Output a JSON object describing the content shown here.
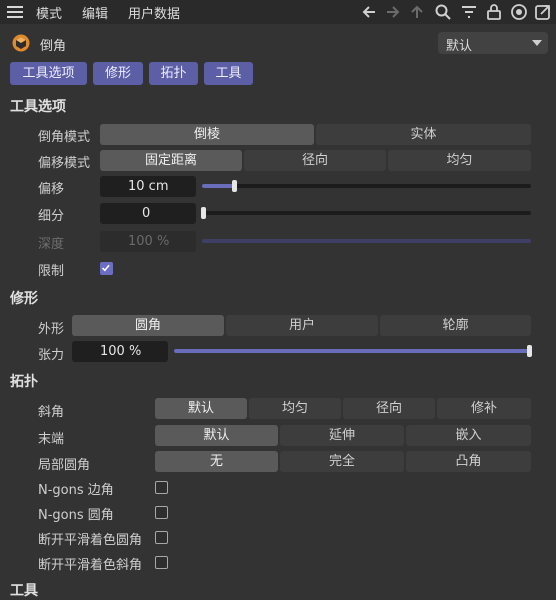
{
  "menu": {
    "items": [
      "模式",
      "编辑",
      "用户数据"
    ]
  },
  "toolbar_icons": [
    "arrow-left-icon",
    "arrow-right-icon",
    "arrow-up-icon",
    "search-icon",
    "filter-icon",
    "lock-icon",
    "target-icon",
    "new-window-icon"
  ],
  "header": {
    "title": "倒角",
    "preset": "默认"
  },
  "tabs": [
    "工具选项",
    "修形",
    "拓扑",
    "工具"
  ],
  "tool_options": {
    "title": "工具选项",
    "bevel_mode": {
      "label": "倒角模式",
      "options": [
        "倒棱",
        "实体"
      ],
      "selected": "倒棱"
    },
    "offset_mode": {
      "label": "偏移模式",
      "options": [
        "固定距离",
        "径向",
        "均匀"
      ],
      "selected": "固定距离"
    },
    "offset": {
      "label": "偏移",
      "value": "10 cm",
      "slider": 0.15
    },
    "subdivision": {
      "label": "细分",
      "value": "0",
      "slider": 0.0
    },
    "depth": {
      "label": "深度",
      "value": "100 %",
      "slider": 1.0
    },
    "limit": {
      "label": "限制",
      "checked": true
    }
  },
  "shaping": {
    "title": "修形",
    "shape": {
      "label": "外形",
      "options": [
        "圆角",
        "用户",
        "轮廓"
      ],
      "selected": "圆角"
    },
    "tension": {
      "label": "张力",
      "value": "100 %",
      "slider": 1.0
    }
  },
  "topology": {
    "title": "拓扑",
    "miter": {
      "label": "斜角",
      "options": [
        "默认",
        "均匀",
        "径向",
        "修补"
      ],
      "selected": "默认"
    },
    "ending": {
      "label": "末端",
      "options": [
        "默认",
        "延伸",
        "嵌入"
      ],
      "selected": "默认"
    },
    "partial_rounding": {
      "label": "局部圆角",
      "options": [
        "无",
        "完全",
        "凸角"
      ],
      "selected": "无"
    },
    "ngons_side": {
      "label": "N-gons 边角",
      "checked": false
    },
    "ngons_round": {
      "label": "N-gons 圆角",
      "checked": false
    },
    "break_phong_round": {
      "label": "断开平滑着色圆角",
      "checked": false
    },
    "break_phong_miter": {
      "label": "断开平滑着色斜角",
      "checked": false
    }
  },
  "tools": {
    "title": "工具"
  },
  "colors": {
    "accent": "#5c5ea6",
    "background": "#333333",
    "slider_fill": "#6a6cbc"
  }
}
